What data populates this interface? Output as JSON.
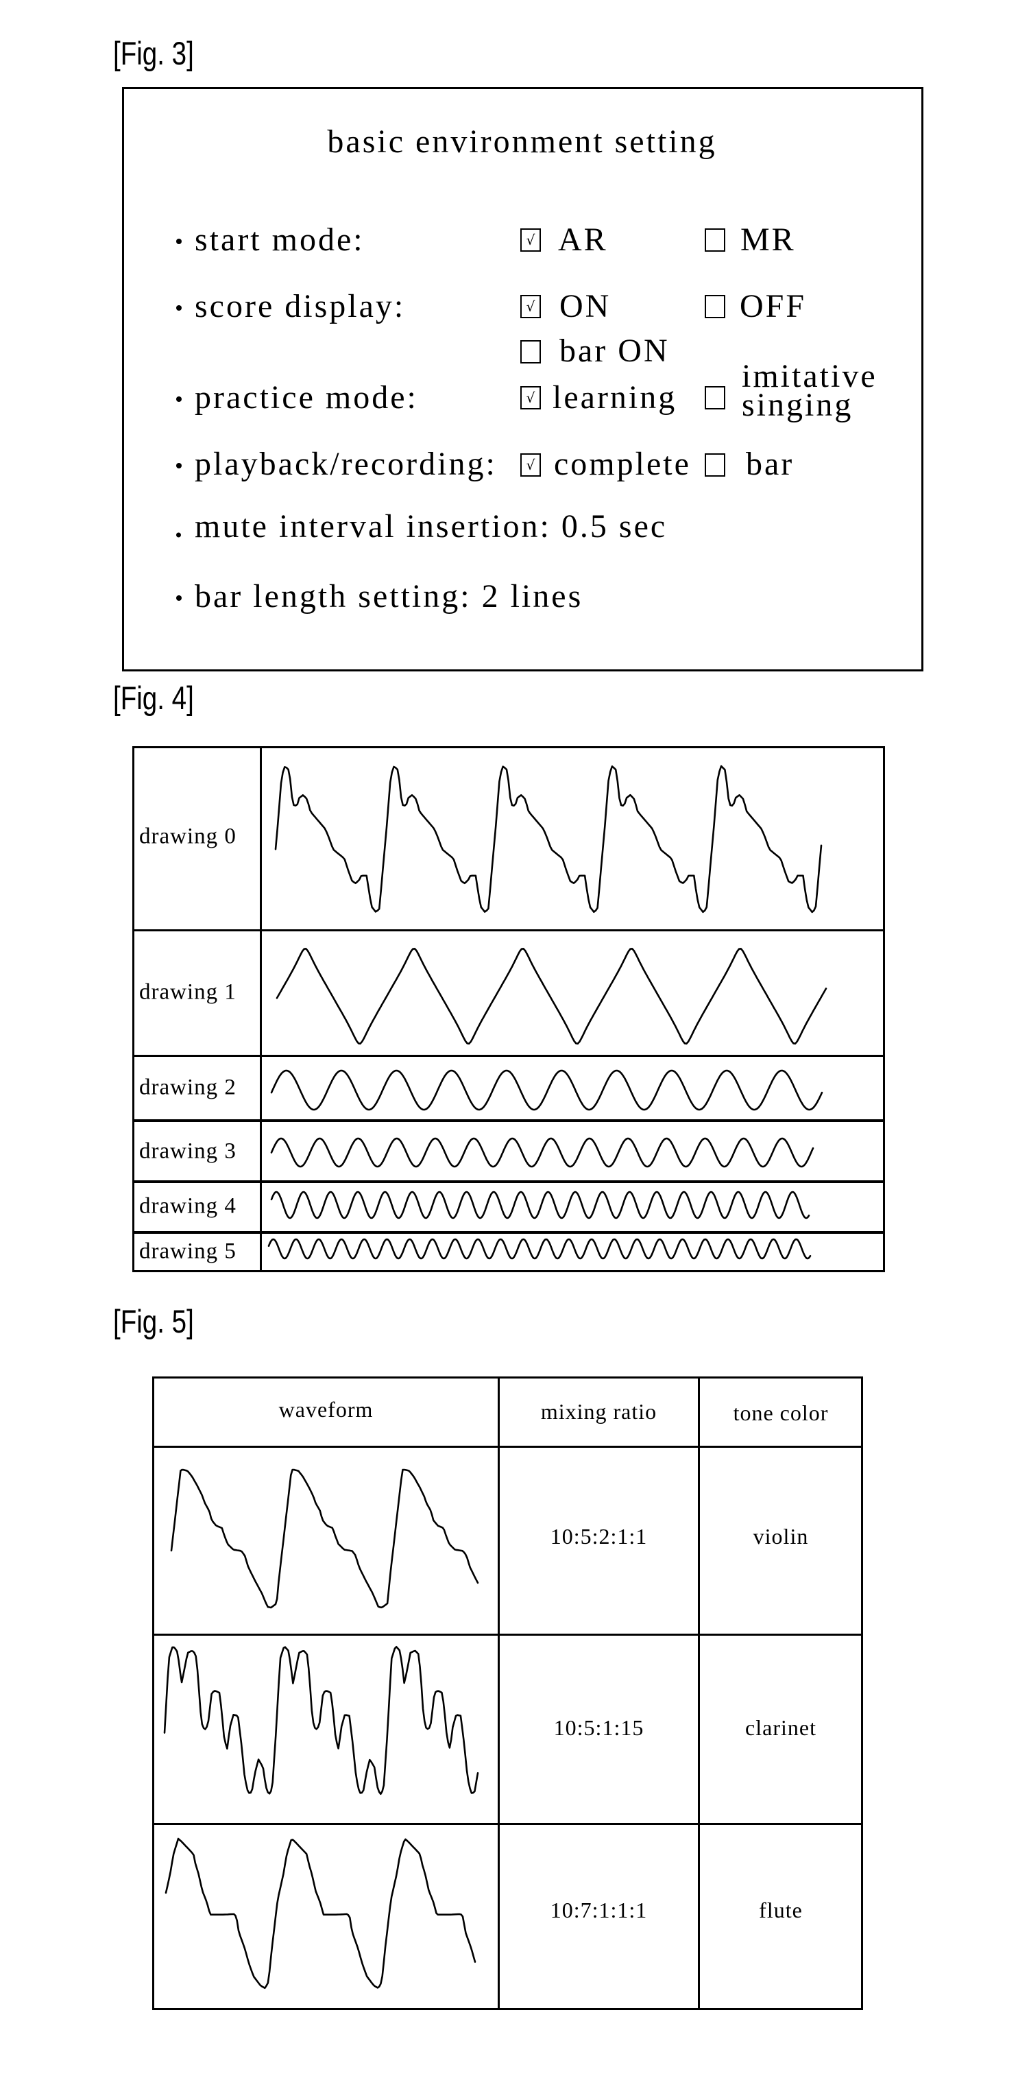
{
  "fig3": {
    "label": "[Fig. 3]",
    "title": "basic environment setting",
    "rows": [
      {
        "label": "start mode:",
        "options": [
          {
            "label": "AR",
            "checked": true
          },
          {
            "label": "MR",
            "checked": false
          }
        ]
      },
      {
        "label": "score display:",
        "options": [
          {
            "label": "ON",
            "checked": true
          },
          {
            "label": "OFF",
            "checked": false
          },
          {
            "label": "bar ON",
            "checked": false
          }
        ]
      },
      {
        "label": "practice mode:",
        "options": [
          {
            "label": "learning",
            "checked": true
          },
          {
            "label": "imitative singing",
            "label_line1": "imitative",
            "label_line2": "singing",
            "checked": false
          }
        ]
      },
      {
        "label": "playback/recording:",
        "options": [
          {
            "label": "complete",
            "checked": true
          },
          {
            "label": "bar",
            "checked": false
          }
        ]
      },
      {
        "label": "mute interval insertion: 0.5 sec"
      },
      {
        "label": "bar length setting: 2 lines"
      }
    ],
    "check_glyph": "√"
  },
  "fig4": {
    "label": "[Fig. 4]",
    "rows": [
      {
        "label": "drawing 0",
        "waveform": {
          "shape": "custom",
          "cycles_shown": 5,
          "start_phase": -0.086,
          "end_phase": 4.917,
          "cycle": [
            [
              0,
              1
            ],
            [
              0.041,
              0.969
            ],
            [
              0.058,
              0.82
            ],
            [
              0.075,
              0.734
            ],
            [
              0.11,
              0.727
            ],
            [
              0.13,
              0.781
            ],
            [
              0.166,
              0.802
            ],
            [
              0.203,
              0.773
            ],
            [
              0.234,
              0.688
            ],
            [
              0.306,
              0.625
            ],
            [
              0.369,
              0.57
            ],
            [
              0.4,
              0.516
            ],
            [
              0.441,
              0.43
            ],
            [
              0.493,
              0.398
            ],
            [
              0.545,
              0.367
            ],
            [
              0.565,
              0.32
            ],
            [
              0.586,
              0.273
            ],
            [
              0.617,
              0.211
            ],
            [
              0.648,
              0.198
            ],
            [
              0.679,
              0.219
            ],
            [
              0.7,
              0.25
            ],
            [
              0.752,
              0.25
            ],
            [
              0.766,
              0.164
            ],
            [
              0.793,
              0.039
            ],
            [
              0.834,
              0
            ],
            [
              0.865,
              0.023
            ],
            [
              0.886,
              0.195
            ],
            [
              0.938,
              0.633
            ],
            [
              0.969,
              0.93
            ],
            [
              1,
              1
            ]
          ]
        }
      },
      {
        "label": "drawing 1",
        "waveform": {
          "shape": "rounded-triangle",
          "cycles_shown": 5,
          "start_phase": -0.26,
          "end_phase": 4.79
        }
      },
      {
        "label": "drawing 2",
        "waveform": {
          "shape": "sine",
          "cycles_shown": 10,
          "start_phase": -0.27,
          "end_phase": 9.73
        }
      },
      {
        "label": "drawing 3",
        "waveform": {
          "shape": "sine",
          "cycles_shown": 14,
          "start_phase": -0.25,
          "end_phase": 13.8
        }
      },
      {
        "label": "drawing 4",
        "waveform": {
          "shape": "sine",
          "cycles_shown": 20,
          "start_phase": -0.18,
          "end_phase": 19.6
        }
      },
      {
        "label": "drawing 5",
        "waveform": {
          "shape": "sine",
          "cycles_shown": 24,
          "start_phase": -0.2,
          "end_phase": 23.62
        }
      }
    ]
  },
  "fig5": {
    "label": "[Fig. 5]",
    "headers": [
      "waveform",
      "mixing ratio",
      "tone color"
    ],
    "rows": [
      {
        "mixing_ratio": "10:5:2:1:1",
        "tone_color": "violin",
        "waveform": {
          "shape": "custom",
          "cycles_shown": 3,
          "start_phase": -0.105,
          "end_phase": 2.66,
          "cycle": [
            [
              0,
              1
            ],
            [
              0.041,
              0.992
            ],
            [
              0.082,
              0.95
            ],
            [
              0.134,
              0.876
            ],
            [
              0.175,
              0.809
            ],
            [
              0.196,
              0.759
            ],
            [
              0.237,
              0.701
            ],
            [
              0.258,
              0.635
            ],
            [
              0.299,
              0.594
            ],
            [
              0.351,
              0.577
            ],
            [
              0.371,
              0.527
            ],
            [
              0.402,
              0.461
            ],
            [
              0.454,
              0.42
            ],
            [
              0.526,
              0.411
            ],
            [
              0.557,
              0.378
            ],
            [
              0.588,
              0.295
            ],
            [
              0.649,
              0.196
            ],
            [
              0.711,
              0.104
            ],
            [
              0.763,
              0.005
            ],
            [
              0.794,
              0
            ],
            [
              0.845,
              0.03
            ],
            [
              0.866,
              0.212
            ],
            [
              0.928,
              0.643
            ],
            [
              0.979,
              1
            ],
            [
              1,
              1
            ]
          ]
        }
      },
      {
        "mixing_ratio": "10:5:1:15",
        "tone_color": "clarinet",
        "waveform": {
          "shape": "custom",
          "cycles_shown": 3,
          "start_phase": -0.074,
          "end_phase": 2.738,
          "cycle": [
            [
              0,
              1
            ],
            [
              0.037,
              0.969
            ],
            [
              0.057,
              0.885
            ],
            [
              0.078,
              0.746
            ],
            [
              0.103,
              0.838
            ],
            [
              0.133,
              0.954
            ],
            [
              0.174,
              0.969
            ],
            [
              0.205,
              0.946
            ],
            [
              0.226,
              0.808
            ],
            [
              0.246,
              0.577
            ],
            [
              0.267,
              0.454
            ],
            [
              0.297,
              0.438
            ],
            [
              0.318,
              0.485
            ],
            [
              0.349,
              0.685
            ],
            [
              0.379,
              0.7
            ],
            [
              0.42,
              0.685
            ],
            [
              0.441,
              0.546
            ],
            [
              0.462,
              0.377
            ],
            [
              0.488,
              0.308
            ],
            [
              0.513,
              0.454
            ],
            [
              0.544,
              0.538
            ],
            [
              0.585,
              0.531
            ],
            [
              0.615,
              0.346
            ],
            [
              0.646,
              0.115
            ],
            [
              0.677,
              0.011
            ],
            [
              0.708,
              0.015
            ],
            [
              0.738,
              0.146
            ],
            [
              0.769,
              0.238
            ],
            [
              0.81,
              0.185
            ],
            [
              0.836,
              0.054
            ],
            [
              0.862,
              0
            ],
            [
              0.892,
              0.038
            ],
            [
              0.923,
              0.377
            ],
            [
              0.964,
              0.915
            ],
            [
              1,
              1
            ]
          ]
        }
      },
      {
        "mixing_ratio": "10:7:1:1:1",
        "tone_color": "flute",
        "waveform": {
          "shape": "custom",
          "cycles_shown": 3,
          "start_phase": -0.109,
          "end_phase": 2.62,
          "cycle": [
            [
              0,
              1
            ],
            [
              0.03,
              0.98
            ],
            [
              0.135,
              0.896
            ],
            [
              0.151,
              0.835
            ],
            [
              0.181,
              0.759
            ],
            [
              0.212,
              0.652
            ],
            [
              0.252,
              0.576
            ],
            [
              0.282,
              0.492
            ],
            [
              0.393,
              0.492
            ],
            [
              0.494,
              0.496
            ],
            [
              0.514,
              0.476
            ],
            [
              0.534,
              0.377
            ],
            [
              0.585,
              0.27
            ],
            [
              0.625,
              0.163
            ],
            [
              0.665,
              0.079
            ],
            [
              0.726,
              0.018
            ],
            [
              0.766,
              0
            ],
            [
              0.796,
              0.041
            ],
            [
              0.827,
              0.27
            ],
            [
              0.877,
              0.591
            ],
            [
              0.927,
              0.759
            ],
            [
              0.958,
              0.896
            ],
            [
              1,
              1
            ]
          ]
        }
      }
    ]
  }
}
